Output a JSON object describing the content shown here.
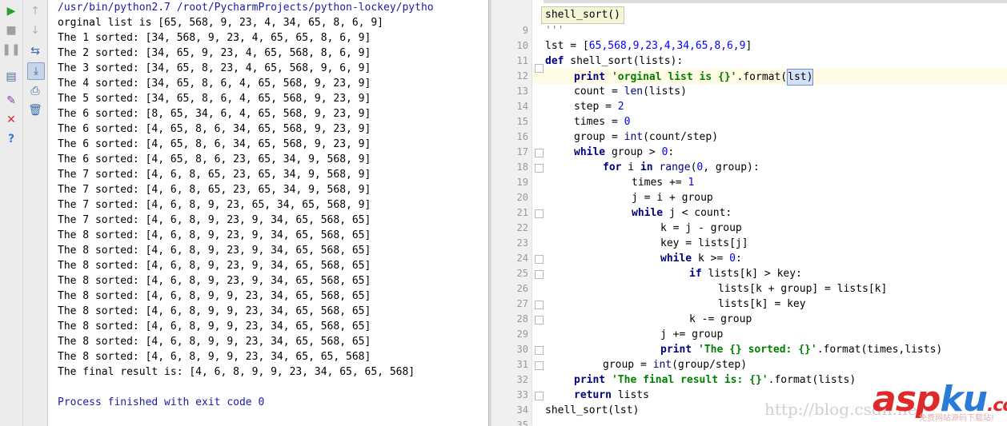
{
  "console": {
    "header": "/usr/bin/python2.7 /root/PycharmProjects/python-lockey/pytho",
    "lines": [
      "orginal list is [65, 568, 9, 23, 4, 34, 65, 8, 6, 9]",
      "The 1 sorted: [34, 568, 9, 23, 4, 65, 65, 8, 6, 9]",
      "The 2 sorted: [34, 65, 9, 23, 4, 65, 568, 8, 6, 9]",
      "The 3 sorted: [34, 65, 8, 23, 4, 65, 568, 9, 6, 9]",
      "The 4 sorted: [34, 65, 8, 6, 4, 65, 568, 9, 23, 9]",
      "The 5 sorted: [34, 65, 8, 6, 4, 65, 568, 9, 23, 9]",
      "The 6 sorted: [8, 65, 34, 6, 4, 65, 568, 9, 23, 9]",
      "The 6 sorted: [4, 65, 8, 6, 34, 65, 568, 9, 23, 9]",
      "The 6 sorted: [4, 65, 8, 6, 34, 65, 568, 9, 23, 9]",
      "The 6 sorted: [4, 65, 8, 6, 23, 65, 34, 9, 568, 9]",
      "The 7 sorted: [4, 6, 8, 65, 23, 65, 34, 9, 568, 9]",
      "The 7 sorted: [4, 6, 8, 65, 23, 65, 34, 9, 568, 9]",
      "The 7 sorted: [4, 6, 8, 9, 23, 65, 34, 65, 568, 9]",
      "The 7 sorted: [4, 6, 8, 9, 23, 9, 34, 65, 568, 65]",
      "The 8 sorted: [4, 6, 8, 9, 23, 9, 34, 65, 568, 65]",
      "The 8 sorted: [4, 6, 8, 9, 23, 9, 34, 65, 568, 65]",
      "The 8 sorted: [4, 6, 8, 9, 23, 9, 34, 65, 568, 65]",
      "The 8 sorted: [4, 6, 8, 9, 23, 9, 34, 65, 568, 65]",
      "The 8 sorted: [4, 6, 8, 9, 9, 23, 34, 65, 568, 65]",
      "The 8 sorted: [4, 6, 8, 9, 9, 23, 34, 65, 568, 65]",
      "The 8 sorted: [4, 6, 8, 9, 9, 23, 34, 65, 568, 65]",
      "The 8 sorted: [4, 6, 8, 9, 9, 23, 34, 65, 568, 65]",
      "The 8 sorted: [4, 6, 8, 9, 9, 23, 34, 65, 65, 568]",
      "The final result is: [4, 6, 8, 9, 9, 23, 34, 65, 65, 568]",
      "",
      "Process finished with exit code 0"
    ]
  },
  "editor": {
    "hint": "shell_sort()",
    "line_numbers": [
      "9",
      "10",
      "11",
      "12",
      "13",
      "14",
      "15",
      "16",
      "17",
      "18",
      "19",
      "20",
      "21",
      "22",
      "23",
      "24",
      "25",
      "26",
      "27",
      "28",
      "29",
      "30",
      "31",
      "32",
      "33",
      "34",
      "35"
    ],
    "code": {
      "l9": "'''",
      "l10_a": "lst = [",
      "l10_b": "65,568,9,23,4,34,65,8,6,9",
      "l10_c": "]",
      "l11_kw": "def",
      "l11_rest": " shell_sort(lists):",
      "l12_kw": "print",
      "l12_str": "'orginal list is {}'",
      "l12_rest": ".format(",
      "l12_arg": "lst)",
      "l13": "count = ",
      "l13_bi": "len",
      "l13_rest": "(lists)",
      "l14": "step = ",
      "l14_num": "2",
      "l15": "times = ",
      "l15_num": "0",
      "l16": "group = ",
      "l16_bi": "int",
      "l16_rest": "(count/step)",
      "l17_kw": "while",
      "l17_rest": " group > ",
      "l17_num": "0",
      "l17_end": ":",
      "l18_kw": "for",
      "l18_a": " i ",
      "l18_kw2": "in",
      "l18_b": " ",
      "l18_bi": "range",
      "l18_c": "(",
      "l18_num": "0",
      "l18_d": ", group):",
      "l19": "times += ",
      "l19_num": "1",
      "l20": "j = i + group",
      "l21_kw": "while",
      "l21_rest": " j < count:",
      "l22": "k = j - group",
      "l23": "key = lists[j]",
      "l24_kw": "while",
      "l24_rest": " k >= ",
      "l24_num": "0",
      "l24_end": ":",
      "l25_kw": "if",
      "l25_rest": " lists[k] > key:",
      "l26": "lists[k + group] = lists[k]",
      "l27": "lists[k] = key",
      "l28": "k -= group",
      "l29": "j += group",
      "l30_kw": "print",
      "l30_str": "'The {} sorted: {}'",
      "l30_rest": ".format(times,lists)",
      "l31": "group = ",
      "l31_bi": "int",
      "l31_rest": "(group/step)",
      "l32_kw": "print",
      "l32_str": "'The final result is: {}'",
      "l32_rest": ".format(lists)",
      "l33_kw": "return",
      "l33_rest": " lists",
      "l34": "shell_sort(lst)"
    }
  },
  "watermark": {
    "url": "http://blog.csdn.ne",
    "logo_a": "asp",
    "logo_b": "ku",
    "logo_c": ".com",
    "sub": "免费网站源码下载站!"
  },
  "toolbar": {
    "run": "run-icon",
    "stop": "stop-icon",
    "pause": "pause-icon",
    "up": "up-arrow-icon",
    "down": "down-arrow-icon"
  },
  "colors": {
    "keyword": "#000080",
    "string": "#008000",
    "number": "#0000ff",
    "console_blue": "#1a1aa6"
  }
}
